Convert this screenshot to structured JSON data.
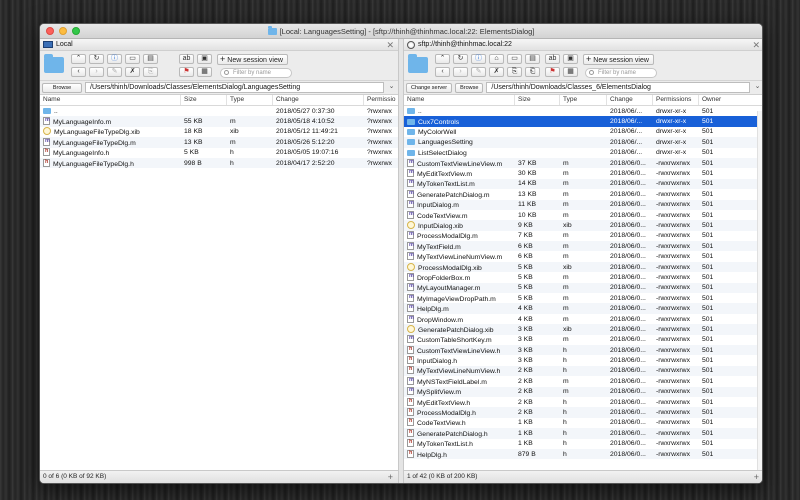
{
  "window": {
    "title": "[Local: LanguagesSetting] - [sftp://thinh@thinhmac.local:22: ElementsDialog]"
  },
  "left": {
    "header": "Local",
    "toolbar": {
      "new_session": "New session view",
      "filter_placeholder": "Filter by name"
    },
    "browse_label": "Browse",
    "path": "/Users/thinh/Downloads/Classes/ElementsDialog/LanguagesSetting",
    "columns": [
      "Name",
      "Size",
      "Type",
      "Change",
      "Permissio"
    ],
    "rows": [
      {
        "icon": "folder",
        "name": "..",
        "size": "",
        "type": "",
        "change": "2018/05/27 0:37:30",
        "perm": "?rwxrwx"
      },
      {
        "icon": "m",
        "name": "MyLanguageInfo.m",
        "size": "55 KB",
        "type": "m",
        "change": "2018/05/18 4:10:52",
        "perm": "?rwxrwx"
      },
      {
        "icon": "xib",
        "name": "MyLanguageFileTypeDlg.xib",
        "size": "18 KB",
        "type": "xib",
        "change": "2018/05/12 11:49:21",
        "perm": "?rwxrwx"
      },
      {
        "icon": "m",
        "name": "MyLanguageFileTypeDlg.m",
        "size": "13 KB",
        "type": "m",
        "change": "2018/05/26 5:12:20",
        "perm": "?rwxrwx"
      },
      {
        "icon": "h",
        "name": "MyLanguageInfo.h",
        "size": "5 KB",
        "type": "h",
        "change": "2018/05/05 19:07:16",
        "perm": "?rwxrwx"
      },
      {
        "icon": "h",
        "name": "MyLanguageFileTypeDlg.h",
        "size": "998 B",
        "type": "h",
        "change": "2018/04/17 2:52:20",
        "perm": "?rwxrwx"
      }
    ],
    "status": "0 of 6 (0 KB of 92 KB)"
  },
  "right": {
    "header": "sftp://thinh@thinhmac.local:22",
    "toolbar": {
      "new_session": "New session view",
      "filter_placeholder": "Filter by name"
    },
    "change_server_label": "Change server",
    "browse_label": "Browse",
    "path": "/Users/thinh/Downloads/Classes_6/ElementsDialog",
    "columns": [
      "Name",
      "Size",
      "Type",
      "Change",
      "Permissions",
      "Owner"
    ],
    "rows": [
      {
        "icon": "folder",
        "name": "..",
        "size": "",
        "type": "",
        "change": "2018/06/...",
        "perm": "drwxr-xr-x",
        "owner": "501"
      },
      {
        "icon": "folder",
        "name": "Cux7Controls",
        "size": "",
        "type": "",
        "change": "2018/06/...",
        "perm": "drwxr-xr-x",
        "owner": "501",
        "selected": true
      },
      {
        "icon": "folder",
        "name": "MyColorWell",
        "size": "",
        "type": "",
        "change": "2018/06/...",
        "perm": "drwxr-xr-x",
        "owner": "501"
      },
      {
        "icon": "folder",
        "name": "LanguagesSetting",
        "size": "",
        "type": "",
        "change": "2018/06/...",
        "perm": "drwxr-xr-x",
        "owner": "501"
      },
      {
        "icon": "folder",
        "name": "ListSelectDialog",
        "size": "",
        "type": "",
        "change": "2018/06/...",
        "perm": "drwxr-xr-x",
        "owner": "501"
      },
      {
        "icon": "m",
        "name": "CustomTextViewLineView.m",
        "size": "37 KB",
        "type": "m",
        "change": "2018/06/0...",
        "perm": "-rwxrwxrwx",
        "owner": "501"
      },
      {
        "icon": "m",
        "name": "MyEditTextView.m",
        "size": "30 KB",
        "type": "m",
        "change": "2018/06/0...",
        "perm": "-rwxrwxrwx",
        "owner": "501"
      },
      {
        "icon": "m",
        "name": "MyTokenTextList.m",
        "size": "14 KB",
        "type": "m",
        "change": "2018/06/0...",
        "perm": "-rwxrwxrwx",
        "owner": "501"
      },
      {
        "icon": "m",
        "name": "GeneratePatchDialog.m",
        "size": "13 KB",
        "type": "m",
        "change": "2018/06/0...",
        "perm": "-rwxrwxrwx",
        "owner": "501"
      },
      {
        "icon": "m",
        "name": "InputDialog.m",
        "size": "11 KB",
        "type": "m",
        "change": "2018/06/0...",
        "perm": "-rwxrwxrwx",
        "owner": "501"
      },
      {
        "icon": "m",
        "name": "CodeTextView.m",
        "size": "10 KB",
        "type": "m",
        "change": "2018/06/0...",
        "perm": "-rwxrwxrwx",
        "owner": "501"
      },
      {
        "icon": "xib",
        "name": "InputDialog.xib",
        "size": "9 KB",
        "type": "xib",
        "change": "2018/06/0...",
        "perm": "-rwxrwxrwx",
        "owner": "501"
      },
      {
        "icon": "m",
        "name": "ProcessModalDlg.m",
        "size": "7 KB",
        "type": "m",
        "change": "2018/06/0...",
        "perm": "-rwxrwxrwx",
        "owner": "501"
      },
      {
        "icon": "m",
        "name": "MyTextField.m",
        "size": "6 KB",
        "type": "m",
        "change": "2018/06/0...",
        "perm": "-rwxrwxrwx",
        "owner": "501"
      },
      {
        "icon": "m",
        "name": "MyTextViewLineNumView.m",
        "size": "6 KB",
        "type": "m",
        "change": "2018/06/0...",
        "perm": "-rwxrwxrwx",
        "owner": "501"
      },
      {
        "icon": "xib",
        "name": "ProcessModalDlg.xib",
        "size": "5 KB",
        "type": "xib",
        "change": "2018/06/0...",
        "perm": "-rwxrwxrwx",
        "owner": "501"
      },
      {
        "icon": "m",
        "name": "DropFolderBox.m",
        "size": "5 KB",
        "type": "m",
        "change": "2018/06/0...",
        "perm": "-rwxrwxrwx",
        "owner": "501"
      },
      {
        "icon": "m",
        "name": "MyLayoutManager.m",
        "size": "5 KB",
        "type": "m",
        "change": "2018/06/0...",
        "perm": "-rwxrwxrwx",
        "owner": "501"
      },
      {
        "icon": "m",
        "name": "MyImageViewDropPath.m",
        "size": "5 KB",
        "type": "m",
        "change": "2018/06/0...",
        "perm": "-rwxrwxrwx",
        "owner": "501"
      },
      {
        "icon": "m",
        "name": "HelpDlg.m",
        "size": "4 KB",
        "type": "m",
        "change": "2018/06/0...",
        "perm": "-rwxrwxrwx",
        "owner": "501"
      },
      {
        "icon": "m",
        "name": "DropWindow.m",
        "size": "4 KB",
        "type": "m",
        "change": "2018/06/0...",
        "perm": "-rwxrwxrwx",
        "owner": "501"
      },
      {
        "icon": "xib",
        "name": "GeneratePatchDialog.xib",
        "size": "3 KB",
        "type": "xib",
        "change": "2018/06/0...",
        "perm": "-rwxrwxrwx",
        "owner": "501"
      },
      {
        "icon": "m",
        "name": "CustomTableShortKey.m",
        "size": "3 KB",
        "type": "m",
        "change": "2018/06/0...",
        "perm": "-rwxrwxrwx",
        "owner": "501"
      },
      {
        "icon": "h",
        "name": "CustomTextViewLineView.h",
        "size": "3 KB",
        "type": "h",
        "change": "2018/06/0...",
        "perm": "-rwxrwxrwx",
        "owner": "501"
      },
      {
        "icon": "h",
        "name": "InputDialog.h",
        "size": "3 KB",
        "type": "h",
        "change": "2018/06/0...",
        "perm": "-rwxrwxrwx",
        "owner": "501"
      },
      {
        "icon": "h",
        "name": "MyTextViewLineNumView.h",
        "size": "2 KB",
        "type": "h",
        "change": "2018/06/0...",
        "perm": "-rwxrwxrwx",
        "owner": "501"
      },
      {
        "icon": "m",
        "name": "MyNSTextFieldLabel.m",
        "size": "2 KB",
        "type": "m",
        "change": "2018/06/0...",
        "perm": "-rwxrwxrwx",
        "owner": "501"
      },
      {
        "icon": "m",
        "name": "MySplitView.m",
        "size": "2 KB",
        "type": "m",
        "change": "2018/06/0...",
        "perm": "-rwxrwxrwx",
        "owner": "501"
      },
      {
        "icon": "h",
        "name": "MyEditTextView.h",
        "size": "2 KB",
        "type": "h",
        "change": "2018/06/0...",
        "perm": "-rwxrwxrwx",
        "owner": "501"
      },
      {
        "icon": "h",
        "name": "ProcessModalDlg.h",
        "size": "2 KB",
        "type": "h",
        "change": "2018/06/0...",
        "perm": "-rwxrwxrwx",
        "owner": "501"
      },
      {
        "icon": "h",
        "name": "CodeTextView.h",
        "size": "1 KB",
        "type": "h",
        "change": "2018/06/0...",
        "perm": "-rwxrwxrwx",
        "owner": "501"
      },
      {
        "icon": "h",
        "name": "GeneratePatchDialog.h",
        "size": "1 KB",
        "type": "h",
        "change": "2018/06/0...",
        "perm": "-rwxrwxrwx",
        "owner": "501"
      },
      {
        "icon": "h",
        "name": "MyTokenTextList.h",
        "size": "1 KB",
        "type": "h",
        "change": "2018/06/0...",
        "perm": "-rwxrwxrwx",
        "owner": "501"
      },
      {
        "icon": "h",
        "name": "HelpDlg.h",
        "size": "879 B",
        "type": "h",
        "change": "2018/06/0...",
        "perm": "-rwxrwxrwx",
        "owner": "501"
      }
    ],
    "status": "1 of 42 (0 KB of 200 KB)"
  }
}
